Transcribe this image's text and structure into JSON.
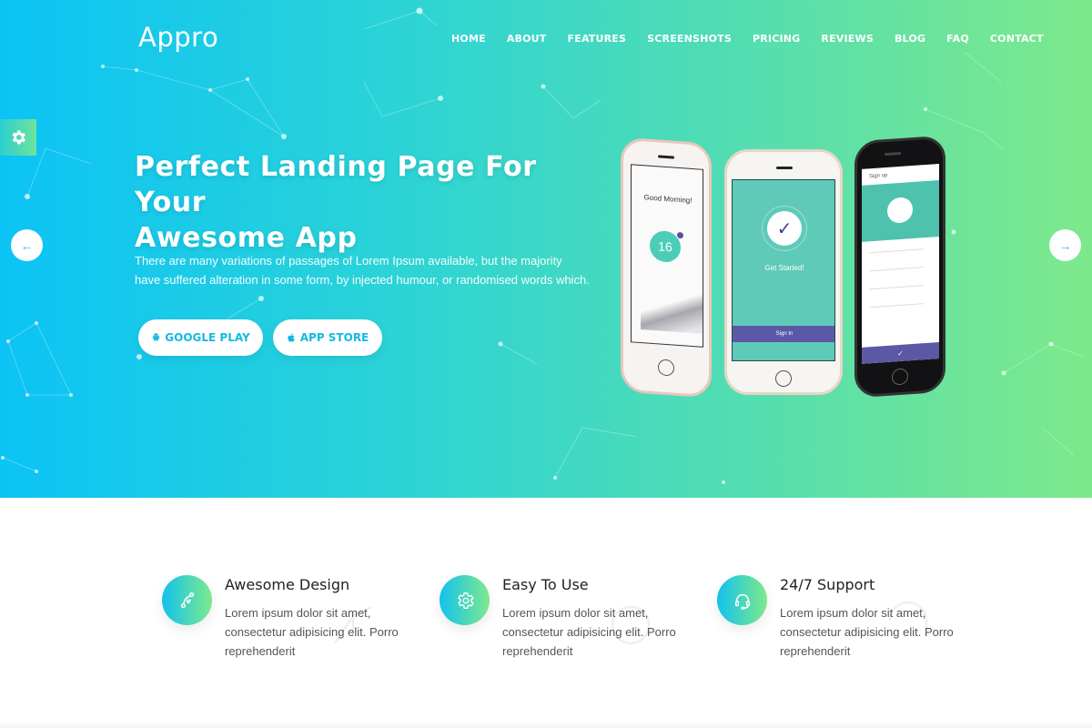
{
  "brand": {
    "logo": "Appro"
  },
  "nav": {
    "items": [
      {
        "label": "HOME"
      },
      {
        "label": "ABOUT"
      },
      {
        "label": "FEATURES"
      },
      {
        "label": "SCREENSHOTS"
      },
      {
        "label": "PRICING"
      },
      {
        "label": "REVIEWS"
      },
      {
        "label": "BLOG"
      },
      {
        "label": "FAQ"
      },
      {
        "label": "CONTACT"
      }
    ]
  },
  "settings": {
    "icon": "gear-icon"
  },
  "hero": {
    "headline_line1": "Perfect Landing Page For Your",
    "headline_line2": "Awesome App",
    "lead": "There are many variations of passages of Lorem Ipsum available, but the majority have suffered alteration in some form, by injected humour, or randomised words which.",
    "buttons": {
      "google": {
        "label": "GOOGLE PLAY",
        "icon": "android-icon"
      },
      "apple": {
        "label": "APP STORE",
        "icon": "apple-icon"
      }
    },
    "slider": {
      "prev_icon": "arrow-left-icon",
      "next_icon": "arrow-right-icon"
    },
    "colors": {
      "gradient_start": "#0cc3f5",
      "gradient_end": "#7ee98b",
      "button_text": "#14b9e3"
    }
  },
  "phones": {
    "left": {
      "greeting": "Good Morning!",
      "number": "16"
    },
    "center": {
      "title": "Get Started!",
      "button": "Sign In"
    },
    "right": {
      "title": "Sign up"
    }
  },
  "features": [
    {
      "title": "Awesome Design",
      "desc": "Lorem ipsum dolor sit amet, consectetur adipisicing elit. Porro reprehenderit",
      "icon": "vector-pen-icon"
    },
    {
      "title": "Easy To Use",
      "desc": "Lorem ipsum dolor sit amet, consectetur adipisicing elit. Porro reprehenderit",
      "icon": "gear-icon"
    },
    {
      "title": "24/7 Support",
      "desc": "Lorem ipsum dolor sit amet, consectetur adipisicing elit. Porro reprehenderit",
      "icon": "headset-icon"
    }
  ]
}
